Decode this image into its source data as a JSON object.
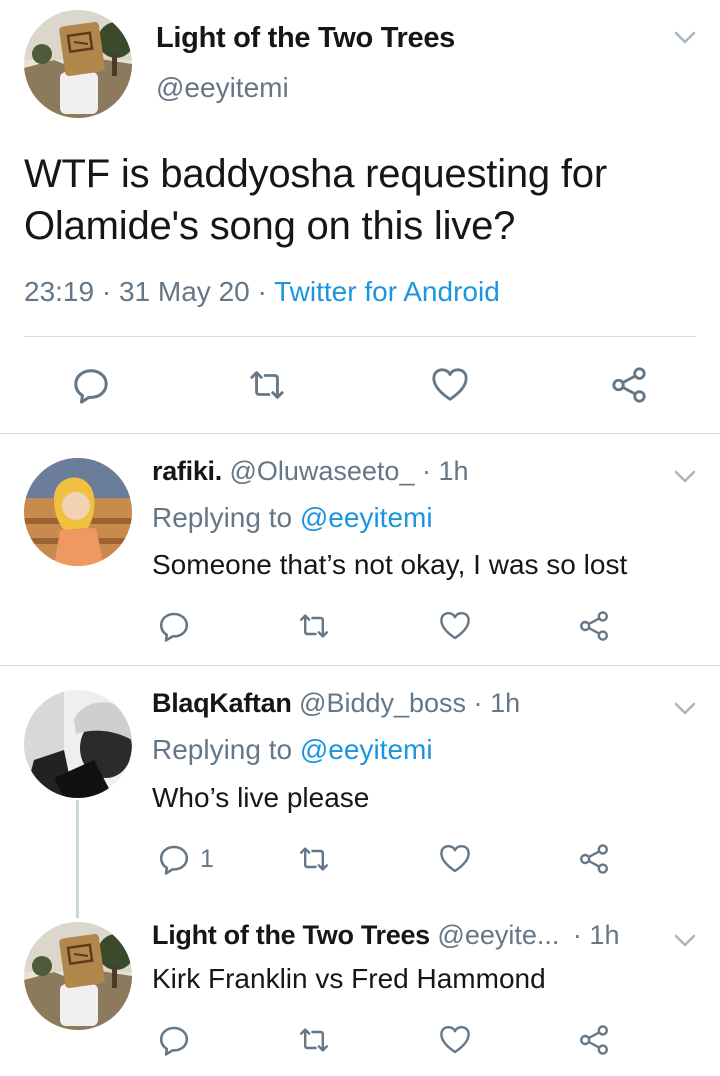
{
  "main_tweet": {
    "name": "Light of the Two Trees",
    "handle": "@eeyitemi",
    "text": "WTF is baddyosha requesting for Olamide's song on this live?",
    "time": "23:19",
    "date": "31 May 20",
    "source": "Twitter for Android",
    "separator": "·"
  },
  "replies": [
    {
      "name": "rafiki.",
      "handle": "@Oluwaseeto_",
      "time": "1h",
      "replying_prefix": "Replying to",
      "replying_to": "@eeyitemi",
      "text": "Someone that’s not okay, I was so lost",
      "reply_count": ""
    },
    {
      "name": "BlaqKaftan",
      "handle": "@Biddy_boss",
      "time": "1h",
      "replying_prefix": "Replying to",
      "replying_to": "@eeyitemi",
      "text": "Who’s live please",
      "reply_count": "1"
    },
    {
      "name": "Light of the Two Trees",
      "handle": "@eeyite...",
      "time": "1h",
      "text": "Kirk Franklin vs Fred Hammond",
      "reply_count": ""
    }
  ],
  "icons": {
    "reply": "reply-icon",
    "retweet": "retweet-icon",
    "like": "heart-icon",
    "share": "share-icon",
    "caret": "chevron-down-icon"
  },
  "colors": {
    "text": "#14171a",
    "secondary": "#657786",
    "link": "#1b95e0",
    "divider": "#d4dbe1"
  }
}
